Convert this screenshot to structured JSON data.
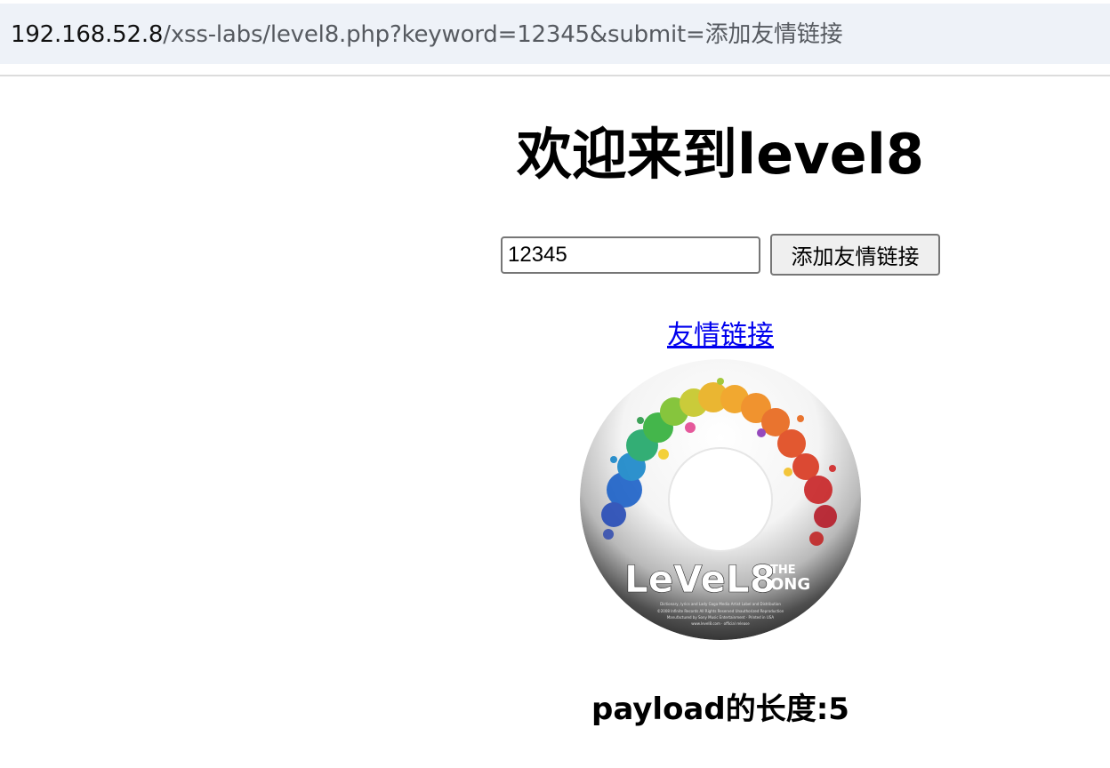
{
  "browser": {
    "url_host": "192.168.52.8",
    "url_path": "/xss-labs/level8.php?keyword=12345&submit=添加友情链接"
  },
  "page": {
    "title": "欢迎来到level8",
    "keyword_input_value": "12345",
    "submit_button_label": "添加友情链接",
    "friend_link_text": "友情链接",
    "payload_length_text": "payload的长度:5"
  },
  "image": {
    "logo_text": "LeVeL8",
    "logo_subtext_top": "THE",
    "logo_subtext_bottom": "ONG",
    "fine_print_lines": [
      "Dictionary, lyrics and Lady Gaga Media Artist Label and Distribution",
      "©2008 Infinite Records All Rights Reserved Unauthorized Reproduction",
      "Manufactured by Sony Music Entertainment · Printed in USA",
      "www.level8.com · official release"
    ]
  }
}
